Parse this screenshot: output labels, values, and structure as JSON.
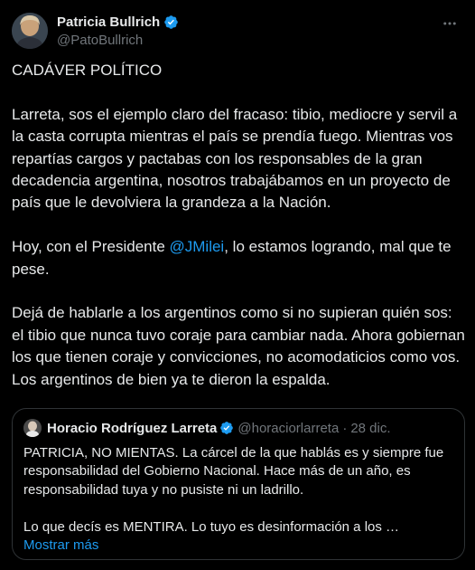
{
  "author": {
    "name": "Patricia Bullrich",
    "handle": "@PatoBullrich"
  },
  "tweet": {
    "title": "CADÁVER POLÍTICO",
    "paragraph1": "Larreta, sos el ejemplo claro del fracaso: tibio, mediocre y servil a la casta corrupta mientras el país se prendía fuego. Mientras vos repartías cargos y pactabas con los responsables de la gran decadencia argentina, nosotros trabajábamos en un proyecto de país que le devolviera la grandeza a la Nación.",
    "paragraph2_before": "Hoy, con el Presidente ",
    "paragraph2_mention": "@JMilei",
    "paragraph2_after": ", lo estamos logrando, mal que te pese.",
    "paragraph3": "Dejá de hablarle a los argentinos como si no supieran quién sos: el tibio que nunca tuvo coraje para cambiar nada. Ahora gobiernan los que tienen coraje y convicciones, no acomodaticios como vos. Los argentinos de bien ya te dieron la espalda."
  },
  "quoted": {
    "name": "Horacio Rodríguez Larreta",
    "handle": "@horaciorlarreta",
    "separator": "·",
    "date": "28 dic.",
    "paragraph1": "PATRICIA, NO MIENTAS. La cárcel de la que hablás es y siempre fue responsabilidad del Gobierno Nacional. Hace más de un año, es responsabilidad tuya y no pusiste ni un ladrillo.",
    "paragraph2": "Lo que decís es MENTIRA. Lo tuyo es desinformación a los …",
    "show_more": "Mostrar más"
  },
  "colors": {
    "background": "#000000",
    "text": "#e7e9ea",
    "secondary": "#71767b",
    "accent": "#1d9bf0",
    "border": "#2f3336"
  },
  "icons": {
    "verified": "verified-badge-icon",
    "more": "more-options-icon"
  }
}
